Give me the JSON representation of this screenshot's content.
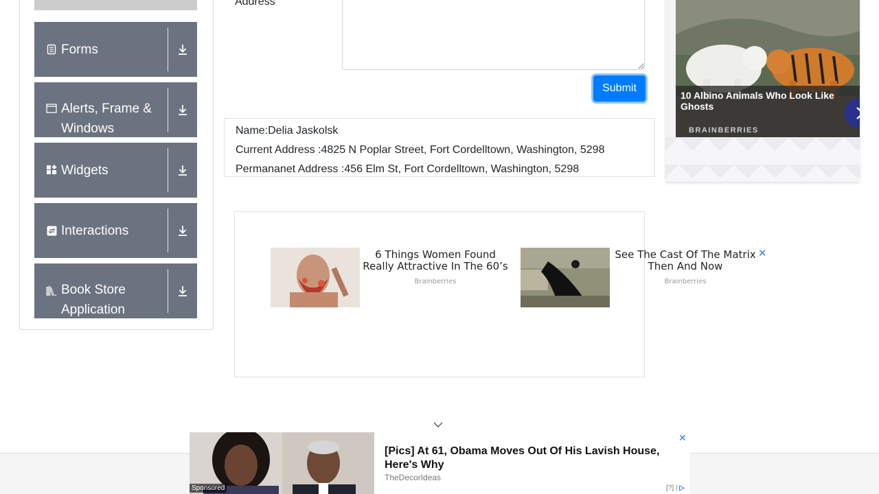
{
  "sidebar": {
    "groups": [
      {
        "label": "Forms",
        "icon": "form-icon"
      },
      {
        "label": "Alerts, Frame & Windows",
        "icon": "window-icon"
      },
      {
        "label": "Widgets",
        "icon": "widgets-icon"
      },
      {
        "label": "Interactions",
        "icon": "interactions-icon"
      },
      {
        "label": "Book Store Application",
        "icon": "books-icon"
      }
    ]
  },
  "form": {
    "address_label": "Address",
    "submit_label": "Submit"
  },
  "output": {
    "name": "Name:Delia Jaskolsk",
    "current_address": "Current Address :4825 N Poplar Street, Fort Cordelltown, Washington, 5298",
    "permanent_address": "Permananet Address :456 Elm St, Fort Cordelltown, Washington, 5298"
  },
  "native_ads": [
    {
      "title": "6 Things Women Found Really Attractive In The 60’s",
      "source": "Brainberries"
    },
    {
      "title": "See The Cast Of The Matrix Then And Now",
      "source": "Brainberries"
    }
  ],
  "right_ad": {
    "title": "10 Albino Animals Who Look Like Ghosts",
    "brand": "BRAINBERRIES"
  },
  "bottom_ad": {
    "sponsored": "Sponsored",
    "title": "[Pics] At 61, Obama Moves Out Of His Lavish House, Here's Why",
    "source": "TheDecorIdeas",
    "info": "[?]"
  },
  "colors": {
    "sidebar_group": "#6b7280",
    "primary": "#007bff"
  }
}
